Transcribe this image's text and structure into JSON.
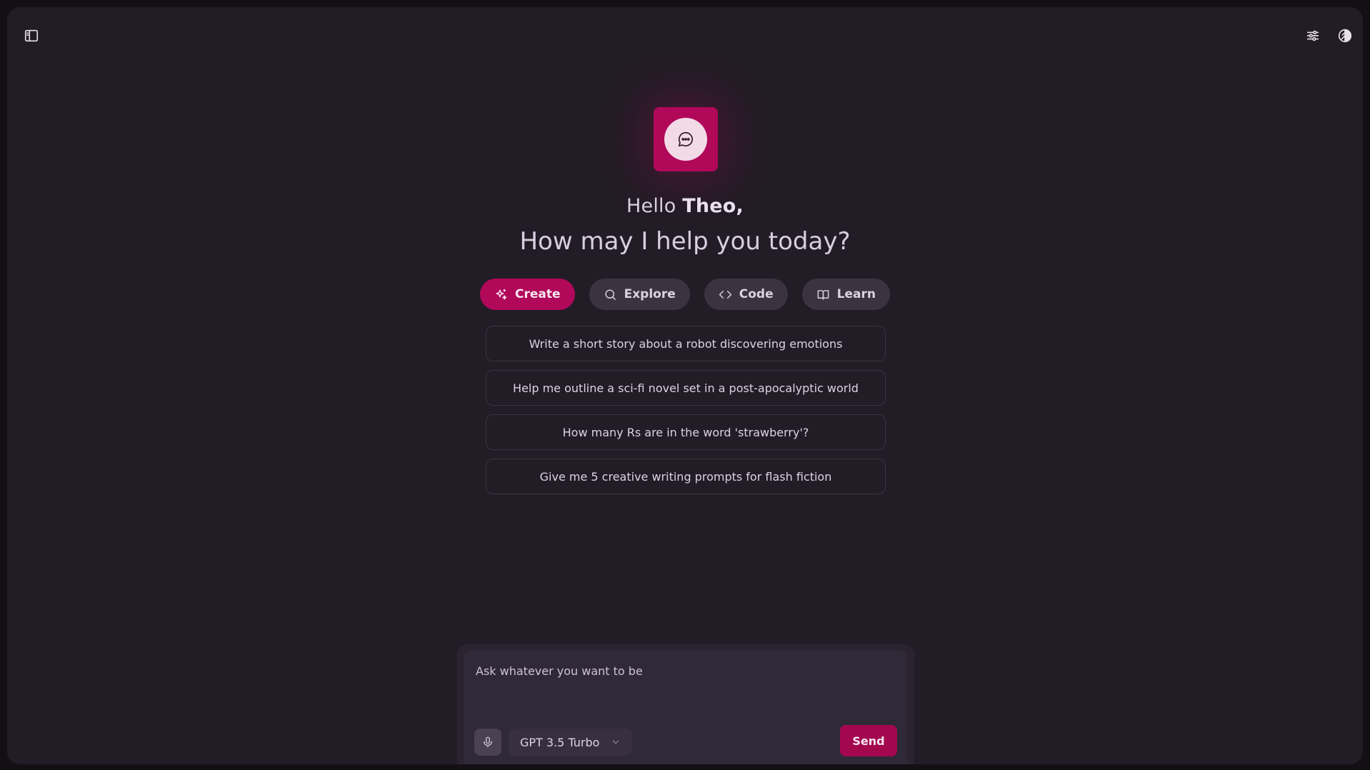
{
  "topbar": {
    "left_icon": "sidebar-toggle-icon",
    "right_icons": [
      "sliders-icon",
      "theme-toggle-icon"
    ]
  },
  "hero": {
    "logo_icon": "chat-bubble-icon",
    "greeting_prefix": "Hello ",
    "user_name": "Theo,",
    "subtitle": "How may I help you today?"
  },
  "tabs": [
    {
      "label": "Create",
      "icon": "sparkles-icon",
      "active": true
    },
    {
      "label": "Explore",
      "icon": "search-icon",
      "active": false
    },
    {
      "label": "Code",
      "icon": "code-icon",
      "active": false
    },
    {
      "label": "Learn",
      "icon": "book-icon",
      "active": false
    }
  ],
  "suggestions": [
    "Write a short story about a robot discovering emotions",
    "Help me outline a sci-fi novel set in a post-apocalyptic world",
    "How many Rs are in the word 'strawberry'?",
    "Give me 5 creative writing prompts for flash fiction"
  ],
  "composer": {
    "placeholder": "Ask whatever you want to be",
    "value": "",
    "mic_icon": "microphone-icon",
    "model": "GPT 3.5 Turbo",
    "send_label": "Send"
  },
  "colors": {
    "background": "#221c26",
    "accent": "#b1085a",
    "text": "#ddd3e3"
  }
}
